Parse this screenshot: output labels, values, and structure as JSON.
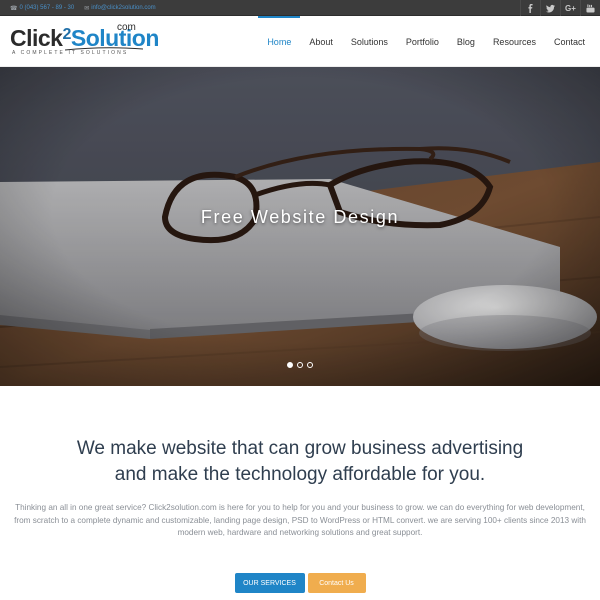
{
  "topbar": {
    "phone": "0 (043) 567 - 89 - 30",
    "email": "info@click2solution.com",
    "social": [
      "facebook-icon",
      "twitter-icon",
      "google-plus-icon",
      "youtube-icon"
    ],
    "google_plus_label": "G+"
  },
  "logo": {
    "part1": "Click",
    "part2": "2",
    "part3": "Solution",
    "dotcom": "com",
    "tagline": "A COMPLETE IT SOLUTIONS"
  },
  "nav": {
    "items": [
      {
        "label": "Home",
        "active": true
      },
      {
        "label": "About"
      },
      {
        "label": "Solutions"
      },
      {
        "label": "Portfolio"
      },
      {
        "label": "Blog"
      },
      {
        "label": "Resources"
      },
      {
        "label": "Contact"
      }
    ]
  },
  "hero": {
    "caption": "Free Website Design",
    "slides": 3,
    "active_slide": 1
  },
  "intro": {
    "headline_line1": "We make website that can grow business advertising",
    "headline_line2": "and make the technology affordable for you.",
    "paragraph": "Thinking an all in one great service? Click2solution.com is here for you to help for you and your business to grow. we can do everything for web development, from scratch to a complete dynamic and customizable, landing page design, PSD to WordPress or HTML convert. we are serving 100+ clients since 2013 with modern web, hardware and networking solutions and great support.",
    "btn_services": "OUR SERVICES",
    "btn_contact": "Contact Us"
  },
  "colors": {
    "accent": "#1f85c7",
    "secondary_button": "#f0ad4e",
    "topbar_bg": "#3c3c3c"
  }
}
